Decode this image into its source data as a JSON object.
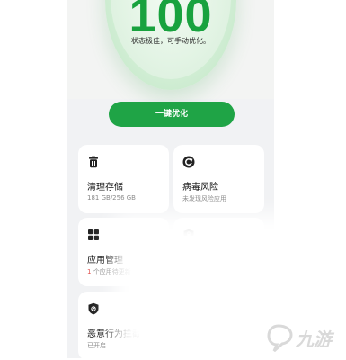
{
  "hero": {
    "score": "100",
    "status_text": "状态极佳，可手动优化。",
    "optimize_label": "一键优化",
    "accent": "#1fa446"
  },
  "cards": [
    {
      "title": "清理存储",
      "sub": "181 GB/256 GB",
      "icon": "trash-icon"
    },
    {
      "title": "病毒风险",
      "sub": "未发现风险应用",
      "icon": "virus-scan-icon"
    },
    {
      "title": "应用管理",
      "sub_num": "1",
      "sub_rest": " 个应用待更新",
      "icon": "grid-apps-icon"
    },
    {
      "title": "",
      "sub": "",
      "icon": "shield-lock-icon"
    },
    {
      "title": "恶意行为拦截",
      "sub": "已开启",
      "icon": "shield-block-icon"
    }
  ],
  "watermark": {
    "text": "九游"
  }
}
